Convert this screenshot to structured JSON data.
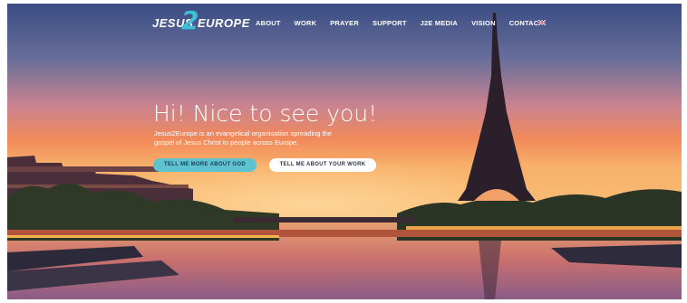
{
  "brand": {
    "word1": "JESUS",
    "digit": "2",
    "word2": "EUROPE"
  },
  "nav": {
    "items": [
      {
        "label": "ABOUT"
      },
      {
        "label": "WORK"
      },
      {
        "label": "PRAYER"
      },
      {
        "label": "SUPPORT"
      },
      {
        "label": "J2E MEDIA"
      },
      {
        "label": "VISION"
      },
      {
        "label": "CONTACT"
      }
    ],
    "language_icon": "uk-flag-icon"
  },
  "hero": {
    "title": "Hi! Nice to see you!",
    "text_line1": "Jesus2Europe is an evangelical organisation spreading the",
    "text_line2": "gospel of Jesus Christ to people across Europe.",
    "button_primary": "TELL ME MORE ABOUT GOD",
    "button_secondary": "TELL ME ABOUT YOUR WORK"
  },
  "colors": {
    "accent": "#5cc3cf",
    "sky_top": "#3b4f85",
    "sunset": "#f2895a"
  }
}
